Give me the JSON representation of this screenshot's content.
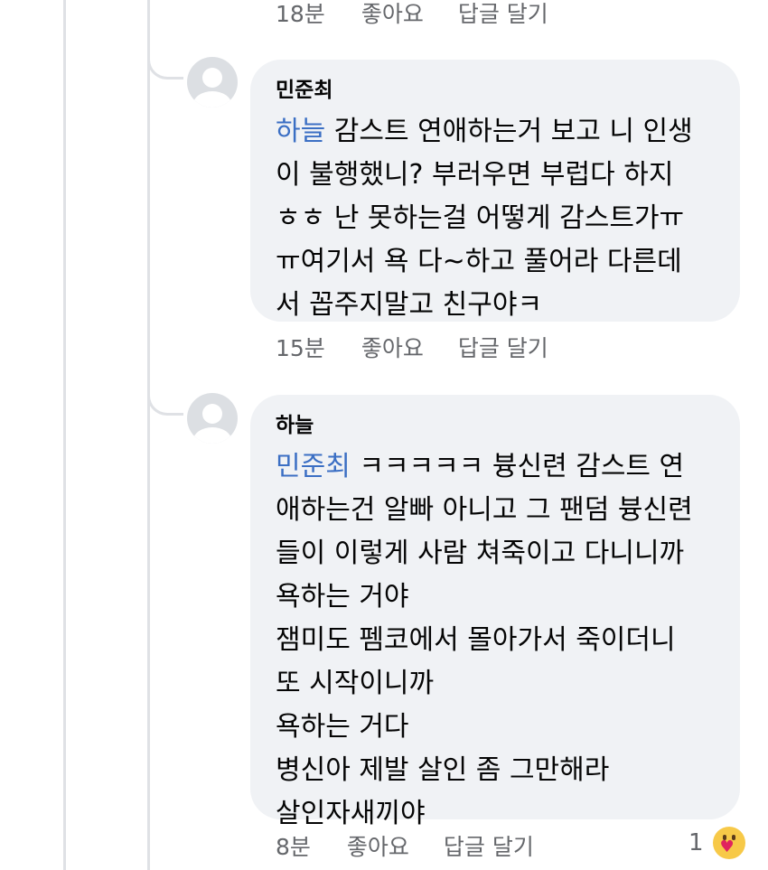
{
  "top_actions": {
    "time": "18분",
    "like": "좋아요",
    "reply": "답글 달기"
  },
  "comments": [
    {
      "author": "민준최",
      "lines": [
        {
          "mention": "하늘",
          "text": " 감스트 연애하는거 보고 니 인생"
        },
        {
          "mention": "",
          "text": "이 불행했니? 부러우면 부럽다 하지"
        },
        {
          "mention": "",
          "text": "ㅎㅎ 난 못하는걸 어떻게 감스트가ㅠ"
        },
        {
          "mention": "",
          "text": "ㅠ여기서 욕 다~하고 풀어라 다른데"
        },
        {
          "mention": "",
          "text": "서 꼽주지말고 친구야ㅋ"
        }
      ],
      "time": "15분",
      "like": "좋아요",
      "reply": "답글 달기"
    },
    {
      "author": "하늘",
      "lines": [
        {
          "mention": "민준최",
          "text": " ㅋㅋㅋㅋㅋ 븅신련 감스트 연"
        },
        {
          "mention": "",
          "text": "애하는건 알빠 아니고 그 팬덤 븅신련"
        },
        {
          "mention": "",
          "text": "들이 이렇게 사람 쳐죽이고 다니니까"
        },
        {
          "mention": "",
          "text": "욕하는 거야"
        },
        {
          "mention": "",
          "text": "잼미도 펨코에서 몰아가서 죽이더니"
        },
        {
          "mention": "",
          "text": "또 시작이니까"
        },
        {
          "mention": "",
          "text": "욕하는 거다"
        },
        {
          "mention": "",
          "text": "병신아 제발 살인 좀 그만해라"
        },
        {
          "mention": "",
          "text": "살인자새끼야"
        }
      ],
      "time": "8분",
      "like": "좋아요",
      "reply": "답글 달기",
      "reaction_count": "1",
      "reaction_icon": "care-hug-emoji-icon"
    }
  ],
  "colors": {
    "bubble": "#f0f2f5",
    "mention": "#3b6fc4",
    "meta_text": "#65676b",
    "thread_line": "#dfe1e5"
  }
}
